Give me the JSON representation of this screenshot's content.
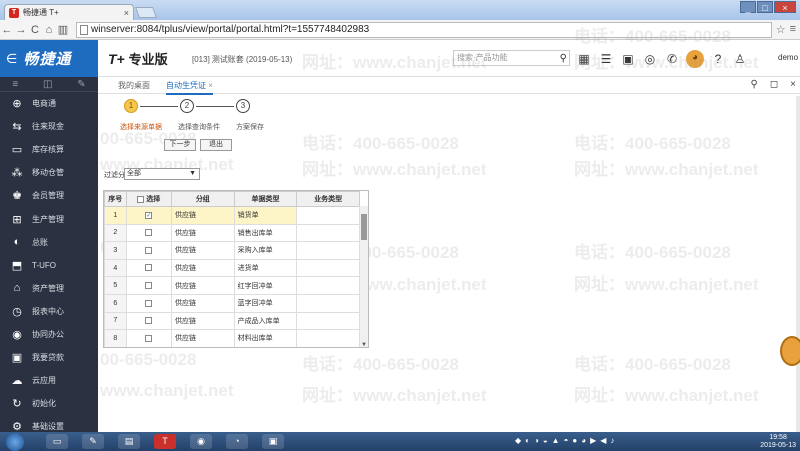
{
  "browser": {
    "tab_title": "畅捷通 T+",
    "tab_close": "×",
    "url": "winserver:8084/tplus/view/portal/portal.html?t=1557748402983",
    "window_buttons": [
      "_",
      "□",
      "×"
    ]
  },
  "header": {
    "brand": "畅捷通",
    "product": "T+",
    "edition": "专业版",
    "account_code": "[013]",
    "account_name": "测试账套",
    "date": "(2019-05-13)",
    "search_placeholder": "搜索·产品功能",
    "user": "demo"
  },
  "sidebar": {
    "items": [
      {
        "label": "电商通",
        "icon": "shop-icon"
      },
      {
        "label": "往来现金",
        "icon": "cash-icon"
      },
      {
        "label": "库存核算",
        "icon": "inventory-icon"
      },
      {
        "label": "移动仓管",
        "icon": "mobile-warehouse-icon"
      },
      {
        "label": "会员管理",
        "icon": "member-icon"
      },
      {
        "label": "生产管理",
        "icon": "production-icon"
      },
      {
        "label": "总账",
        "icon": "ledger-icon"
      },
      {
        "label": "T-UFO",
        "icon": "ufo-icon"
      },
      {
        "label": "资产管理",
        "icon": "asset-icon"
      },
      {
        "label": "报表中心",
        "icon": "report-icon"
      },
      {
        "label": "协同办公",
        "icon": "collab-icon"
      },
      {
        "label": "我要贷款",
        "icon": "loan-icon"
      },
      {
        "label": "云应用",
        "icon": "cloud-icon"
      },
      {
        "label": "初始化",
        "icon": "init-icon"
      },
      {
        "label": "基础设置",
        "icon": "settings-icon"
      }
    ]
  },
  "tabs": {
    "home": "我的桌面",
    "active": "自动生凭证",
    "active_close": "×"
  },
  "wizard": {
    "steps": [
      {
        "num": "1",
        "label": "选择来源单据"
      },
      {
        "num": "2",
        "label": "选择查询条件"
      },
      {
        "num": "3",
        "label": "方案保存"
      }
    ],
    "next_button": "下一步",
    "exit_button": "退出"
  },
  "filter": {
    "label": "过滤分组",
    "value": "全部"
  },
  "table": {
    "headers": [
      "序号",
      "选择",
      "分组",
      "单据类型",
      "业务类型"
    ],
    "rows": [
      {
        "num": "1",
        "checked": true,
        "group": "供应链",
        "doc_type": "销货单",
        "biz_type": ""
      },
      {
        "num": "2",
        "checked": false,
        "group": "供应链",
        "doc_type": "销售出库单",
        "biz_type": ""
      },
      {
        "num": "3",
        "checked": false,
        "group": "供应链",
        "doc_type": "采购入库单",
        "biz_type": ""
      },
      {
        "num": "4",
        "checked": false,
        "group": "供应链",
        "doc_type": "进货单",
        "biz_type": ""
      },
      {
        "num": "5",
        "checked": false,
        "group": "供应链",
        "doc_type": "红字回冲单",
        "biz_type": ""
      },
      {
        "num": "6",
        "checked": false,
        "group": "供应链",
        "doc_type": "蓝字回冲单",
        "biz_type": ""
      },
      {
        "num": "7",
        "checked": false,
        "group": "供应链",
        "doc_type": "产成品入库单",
        "biz_type": ""
      },
      {
        "num": "8",
        "checked": false,
        "group": "供应链",
        "doc_type": "材料出库单",
        "biz_type": ""
      }
    ]
  },
  "watermark": {
    "phone": "电话：400-665-0028",
    "site": "网址：www.chanjet.net",
    "phone_short": "00-665-0028",
    "site_short": "www.chanjet.net",
    "phone_tail": "400-665-0028"
  },
  "taskbar": {
    "time": "19:58",
    "date": "2019-05-13"
  },
  "colors": {
    "brand_blue": "#1e6cc0",
    "sidebar_bg": "#2b3140",
    "step_active": "#f7c64d",
    "step_label": "#c9540c"
  }
}
